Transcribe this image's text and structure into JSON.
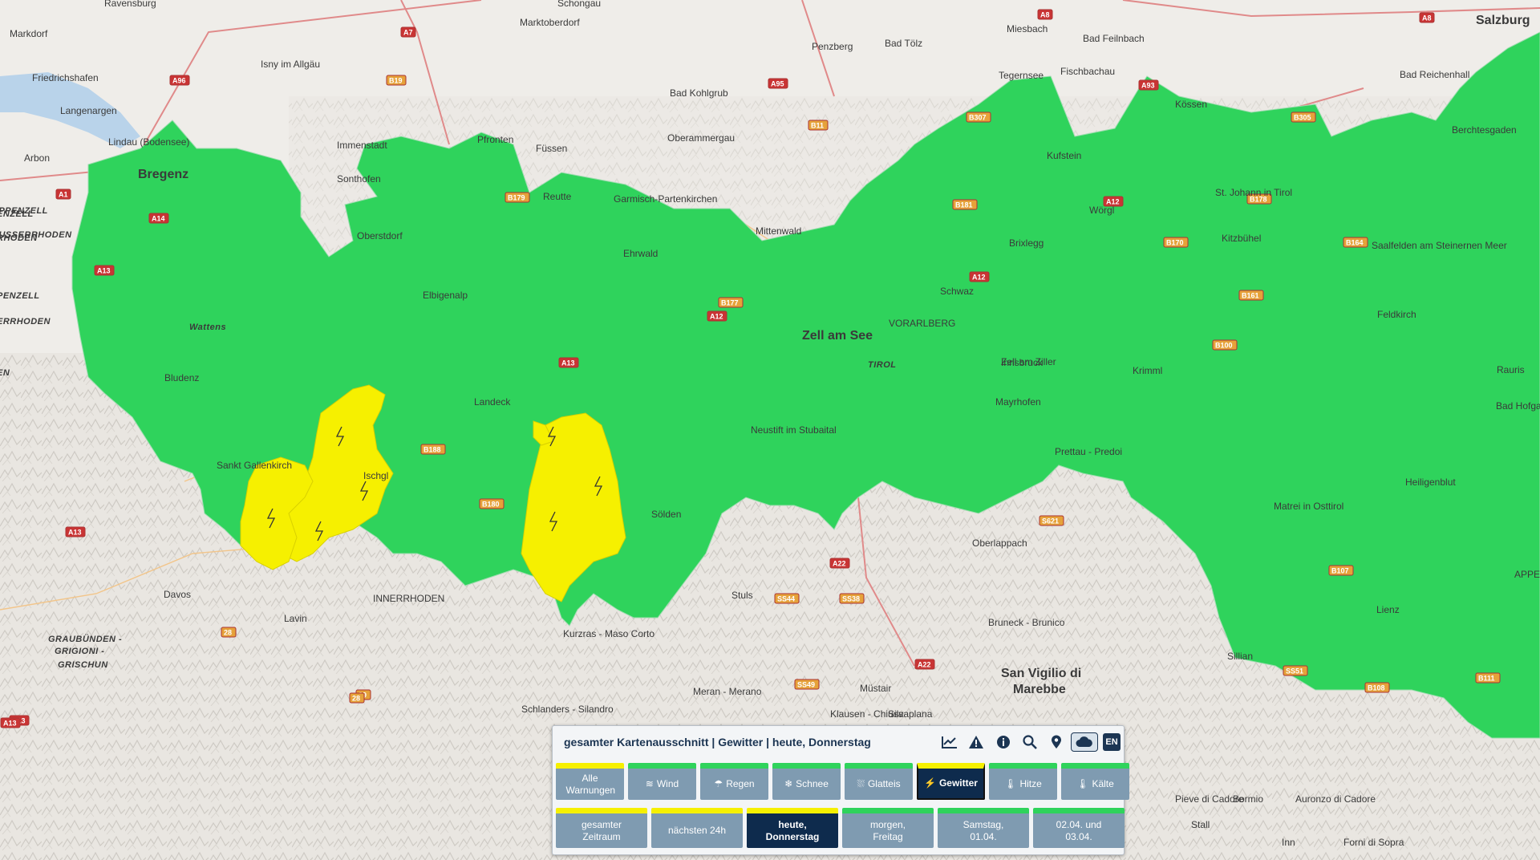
{
  "map": {
    "colors": {
      "green_warning": "#2fd35c",
      "yellow_warning": "#f6f000",
      "background": "#e9e6e1"
    },
    "places": [
      {
        "name": "Ravensburg"
      },
      {
        "name": "Schongau"
      },
      {
        "name": "Marktoberdorf"
      },
      {
        "name": "Markdorf"
      },
      {
        "name": "Isny im Allgäu"
      },
      {
        "name": "Penzberg"
      },
      {
        "name": "Bad Tölz"
      },
      {
        "name": "Miesbach"
      },
      {
        "name": "Bad Feilnbach"
      },
      {
        "name": "Salzburg"
      },
      {
        "name": "Friedrichshafen"
      },
      {
        "name": "Langenargen"
      },
      {
        "name": "Tegernsee"
      },
      {
        "name": "Fischbachau"
      },
      {
        "name": "Bad Reichenhall"
      },
      {
        "name": "Bad Kohlgrub"
      },
      {
        "name": "Kössen"
      },
      {
        "name": "Berchtesgaden"
      },
      {
        "name": "Oberammergau"
      },
      {
        "name": "Lindau (Bodensee)"
      },
      {
        "name": "Immenstadt"
      },
      {
        "name": "Pfronten"
      },
      {
        "name": "Füssen"
      },
      {
        "name": "Arbon"
      },
      {
        "name": "Kufstein"
      },
      {
        "name": "Bregenz"
      },
      {
        "name": "Sonthofen"
      },
      {
        "name": "Reutte"
      },
      {
        "name": "Garmisch-Partenkirchen"
      },
      {
        "name": "St. Johann in Tirol"
      },
      {
        "name": "Wörgl"
      },
      {
        "name": "Oberstdorf"
      },
      {
        "name": "Mittenwald"
      },
      {
        "name": "Brixlegg"
      },
      {
        "name": "Kitzbühel"
      },
      {
        "name": "Ehrwald"
      },
      {
        "name": "Saalfelden am Steinernen Meer"
      },
      {
        "name": "Schwaz"
      },
      {
        "name": "Elbigenalp"
      },
      {
        "name": "Feldkirch"
      },
      {
        "name": "VORARLBERG"
      },
      {
        "name": "Zell am See"
      },
      {
        "name": "Wattens"
      },
      {
        "name": "Innsbruck"
      },
      {
        "name": "Bludenz"
      },
      {
        "name": "TIROL"
      },
      {
        "name": "Zell am Ziller"
      },
      {
        "name": "Krimml"
      },
      {
        "name": "Rauris"
      },
      {
        "name": "Landeck"
      },
      {
        "name": "Mayrhofen"
      },
      {
        "name": "Bad Hofgastein"
      },
      {
        "name": "Neustift im Stubaital"
      },
      {
        "name": "Sankt Gallenkirch"
      },
      {
        "name": "Ischgl"
      },
      {
        "name": "Prettau - Predoi"
      },
      {
        "name": "Heiligenblut"
      },
      {
        "name": "Sölden"
      },
      {
        "name": "Matrei in Osttirol"
      },
      {
        "name": "Oberlappach"
      },
      {
        "name": "Davos"
      },
      {
        "name": "Lavin"
      },
      {
        "name": "Stuls"
      },
      {
        "name": "Bruneck - Brunico"
      },
      {
        "name": "Lienz"
      },
      {
        "name": "GRAUBÜNDEN -"
      },
      {
        "name": "GRIGIONI -"
      },
      {
        "name": "GRISCHUN"
      },
      {
        "name": "Kurzras - Maso Corto"
      },
      {
        "name": "San Vigilio di"
      },
      {
        "name": "Marebbe"
      },
      {
        "name": "Sillian"
      },
      {
        "name": "Meran - Merano"
      },
      {
        "name": "Müstair"
      },
      {
        "name": "Schlanders - Silandro"
      },
      {
        "name": "Klausen - Chiusa"
      },
      {
        "name": "Silvaplana"
      },
      {
        "name": "Bormio"
      },
      {
        "name": "Auronzo di Cadore"
      },
      {
        "name": "Pieve di Cadore"
      },
      {
        "name": "Forni di Sopra"
      },
      {
        "name": "Stall"
      },
      {
        "name": "Inn"
      },
      {
        "name": "APPENZELL"
      },
      {
        "name": "INNERRHODEN"
      },
      {
        "name": "APPENZELL"
      },
      {
        "name": "AUSSERRHODEN"
      }
    ],
    "road_shields": [
      "A96",
      "A7",
      "A8",
      "A8",
      "B19",
      "A95",
      "B11",
      "B307",
      "A93",
      "B305",
      "A1",
      "A14",
      "A13",
      "B179",
      "B181",
      "A12",
      "B178",
      "B170",
      "B164",
      "B161",
      "B177",
      "A12",
      "A13",
      "A12",
      "B100",
      "B188",
      "B180",
      "B107",
      "B108",
      "B111",
      "A13",
      "S621",
      "A22",
      "SS44",
      "SS38",
      "A22",
      "SS49",
      "SS51",
      "A13",
      "28",
      "29",
      "28",
      "A13"
    ],
    "region_labels_partial": [
      "ENZELL",
      "RHODEN",
      "PENZELL",
      "ERRHODEN",
      "EN"
    ]
  },
  "panel": {
    "title": "gesamter Kartenausschnitt | Gewitter | heute, Donnerstag",
    "tools": [
      {
        "icon": "chart-icon",
        "glyph": "📈"
      },
      {
        "icon": "warning-icon",
        "glyph": "⚠"
      },
      {
        "icon": "info-icon",
        "glyph": "ℹ"
      },
      {
        "icon": "zoom-icon",
        "glyph": "🔍"
      },
      {
        "icon": "location-icon",
        "glyph": "📍"
      },
      {
        "icon": "cloud-icon",
        "glyph": "☁"
      },
      {
        "icon": "language-button",
        "glyph": "EN"
      }
    ],
    "types": [
      {
        "label": "Alle Warnungen",
        "level": "yellow",
        "active": false,
        "icon": ""
      },
      {
        "label": "Wind",
        "level": "green",
        "active": false,
        "icon": "≋"
      },
      {
        "label": "Regen",
        "level": "green",
        "active": false,
        "icon": "☂"
      },
      {
        "label": "Schnee",
        "level": "green",
        "active": false,
        "icon": "❄"
      },
      {
        "label": "Glatteis",
        "level": "green",
        "active": false,
        "icon": "⛆"
      },
      {
        "label": "Gewitter",
        "level": "yellow",
        "active": true,
        "icon": "⚡"
      },
      {
        "label": "Hitze",
        "level": "green",
        "active": false,
        "icon": "🌡"
      },
      {
        "label": "Kälte",
        "level": "green",
        "active": false,
        "icon": "🌡"
      }
    ],
    "times": [
      {
        "label": "gesamter Zeitraum",
        "level": "yellow",
        "active": false
      },
      {
        "label": "nächsten 24h",
        "level": "yellow",
        "active": false
      },
      {
        "label": "heute, Donnerstag",
        "level": "yellow",
        "active": true
      },
      {
        "label": "morgen, Freitag",
        "level": "green",
        "active": false
      },
      {
        "label": "Samstag, 01.04.",
        "level": "green",
        "active": false
      },
      {
        "label": "02.04. und 03.04.",
        "level": "green",
        "active": false
      }
    ]
  }
}
